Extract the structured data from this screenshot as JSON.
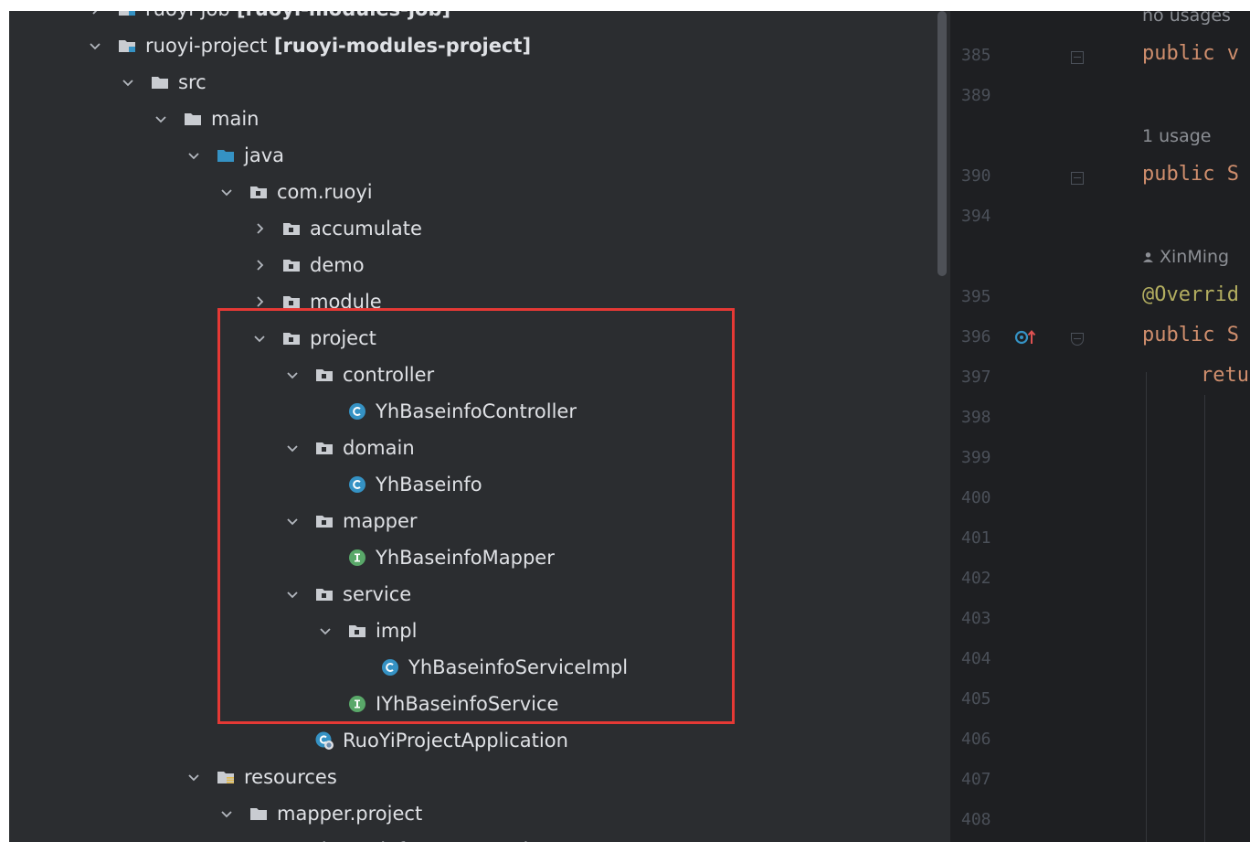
{
  "tree": {
    "items": [
      {
        "indent": 0,
        "expanded": false,
        "icon": "module-folder-icon",
        "name": "ruoyi-job",
        "module": "[ruoyi-modules-job]"
      },
      {
        "indent": 0,
        "expanded": true,
        "icon": "module-folder-icon",
        "name": "ruoyi-project",
        "module": "[ruoyi-modules-project]"
      },
      {
        "indent": 1,
        "expanded": true,
        "icon": "folder-icon",
        "name": "src"
      },
      {
        "indent": 2,
        "expanded": true,
        "icon": "folder-icon",
        "name": "main"
      },
      {
        "indent": 3,
        "expanded": true,
        "icon": "source-folder-icon",
        "name": "java"
      },
      {
        "indent": 4,
        "expanded": true,
        "icon": "package-icon",
        "name": "com.ruoyi"
      },
      {
        "indent": 5,
        "expanded": false,
        "icon": "package-icon",
        "name": "accumulate"
      },
      {
        "indent": 5,
        "expanded": false,
        "icon": "package-icon",
        "name": "demo"
      },
      {
        "indent": 5,
        "expanded": false,
        "icon": "package-icon",
        "name": "module"
      },
      {
        "indent": 5,
        "expanded": true,
        "icon": "package-icon",
        "name": "project"
      },
      {
        "indent": 6,
        "expanded": true,
        "icon": "package-icon",
        "name": "controller"
      },
      {
        "indent": 7,
        "icon": "class-icon",
        "name": "YhBaseinfoController"
      },
      {
        "indent": 6,
        "expanded": true,
        "icon": "package-icon",
        "name": "domain"
      },
      {
        "indent": 7,
        "icon": "class-icon",
        "name": "YhBaseinfo"
      },
      {
        "indent": 6,
        "expanded": true,
        "icon": "package-icon",
        "name": "mapper"
      },
      {
        "indent": 7,
        "icon": "interface-icon",
        "name": "YhBaseinfoMapper"
      },
      {
        "indent": 6,
        "expanded": true,
        "icon": "package-icon",
        "name": "service"
      },
      {
        "indent": 7,
        "expanded": true,
        "icon": "package-icon",
        "name": "impl"
      },
      {
        "indent": 8,
        "icon": "class-icon",
        "name": "YhBaseinfoServiceImpl"
      },
      {
        "indent": 7,
        "icon": "interface-icon",
        "name": "IYhBaseinfoService"
      },
      {
        "indent": 6,
        "icon": "spring-boot-class-icon",
        "name": "RuoYiProjectApplication"
      },
      {
        "indent": 3,
        "expanded": true,
        "icon": "resources-folder-icon",
        "name": "resources"
      },
      {
        "indent": 4,
        "expanded": true,
        "icon": "folder-icon",
        "name": "mapper.project"
      },
      {
        "indent": 5,
        "icon": "xml-file-icon",
        "name": "YhBaseinfoMapper.xml"
      }
    ]
  },
  "editor": {
    "hints": {
      "no_usages": "no usages",
      "one_usage": "1 usage",
      "author": "XinMing"
    },
    "line_numbers": [
      "385",
      "389",
      "390",
      "394",
      "395",
      "396",
      "397",
      "398",
      "399",
      "400",
      "401",
      "402",
      "403",
      "404",
      "405",
      "406",
      "407",
      "408"
    ],
    "code": {
      "l385": "public v",
      "l390": "public S",
      "l395": "@Overrid",
      "l396": "public S",
      "l397": "retu"
    }
  },
  "colors": {
    "tree_bg": "#2b2d30",
    "editor_bg": "#1e1f22",
    "highlight": "#e53935",
    "keyword": "#cf8e6d",
    "annotation": "#b3ae60"
  }
}
